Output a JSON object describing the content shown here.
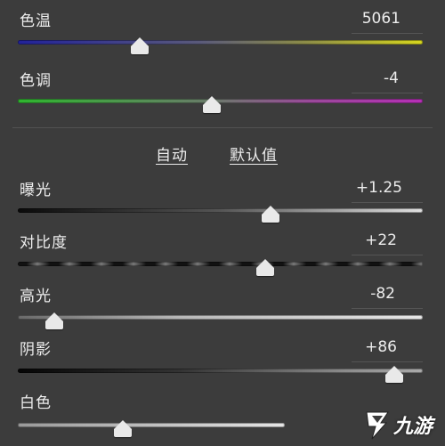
{
  "sliders": [
    {
      "id": "temperature",
      "label": "色温",
      "value": "5061",
      "level": 0.3,
      "track": "temp"
    },
    {
      "id": "tint",
      "label": "色调",
      "value": "-4",
      "level": 0.48,
      "track": "tint"
    },
    {
      "id": "exposure",
      "label": "曝光",
      "value": "+1.25",
      "level": 0.625,
      "track": "gray"
    },
    {
      "id": "contrast",
      "label": "对比度",
      "value": "+22",
      "level": 0.61,
      "track": "contrast"
    },
    {
      "id": "highlights",
      "label": "高光",
      "value": "-82",
      "level": 0.09,
      "track": "gray"
    },
    {
      "id": "shadows",
      "label": "阴影",
      "value": "+86",
      "level": 0.93,
      "track": "gray"
    },
    {
      "id": "whites",
      "label": "白色",
      "value": "",
      "level": 0.26,
      "track": "gray"
    }
  ],
  "actions": {
    "auto_label": "自动",
    "default_label": "默认值"
  },
  "watermark": {
    "text": "九游",
    "icon": "jiuyou-logo-icon"
  },
  "colors": {
    "panel_bg": "#3c3c3c",
    "thumb": "#e9e9e9",
    "temp_start": "#2a2aa8",
    "temp_end": "#d8d820",
    "tint_start": "#32b832",
    "tint_end": "#b832b8"
  }
}
